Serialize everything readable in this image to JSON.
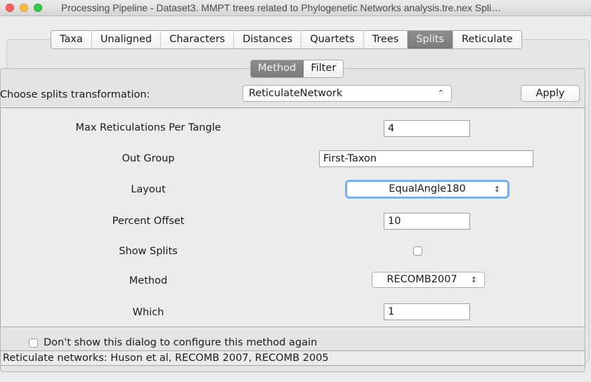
{
  "window": {
    "title": "Processing Pipeline - Dataset3. MMPT trees related to Phylogenetic Networks analysis.tre.nex Spli…"
  },
  "main_tabs": [
    {
      "label": "Taxa"
    },
    {
      "label": "Unaligned"
    },
    {
      "label": "Characters"
    },
    {
      "label": "Distances"
    },
    {
      "label": "Quartets"
    },
    {
      "label": "Trees"
    },
    {
      "label": "Splits",
      "active": true
    },
    {
      "label": "Reticulate"
    }
  ],
  "sub_tabs": [
    {
      "label": "Method",
      "active": true
    },
    {
      "label": "Filter"
    }
  ],
  "transform": {
    "label": "Choose splits transformation:",
    "selected": "ReticulateNetwork",
    "apply_label": "Apply"
  },
  "params": {
    "max_reticulations": {
      "label": "Max Reticulations Per Tangle",
      "value": "4"
    },
    "out_group": {
      "label": "Out Group",
      "value": "First-Taxon"
    },
    "layout": {
      "label": "Layout",
      "value": "EqualAngle180"
    },
    "percent_offset": {
      "label": "Percent Offset",
      "value": "10"
    },
    "show_splits": {
      "label": "Show Splits",
      "checked": false
    },
    "method": {
      "label": "Method",
      "value": "RECOMB2007"
    },
    "which": {
      "label": "Which",
      "value": "1"
    }
  },
  "footer": {
    "dont_show_label": "Don't show this dialog to configure this method again",
    "status": "Reticulate networks: Huson et al, RECOMB 2007, RECOMB 2005"
  },
  "icons": {
    "arrows": "updown-arrows-icon"
  }
}
